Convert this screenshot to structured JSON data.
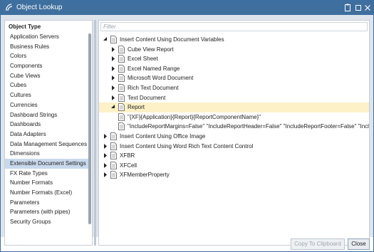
{
  "window": {
    "title": "Object Lookup",
    "colors": {
      "titlebar": "#3e6f9e",
      "selection": "#c9d9ed",
      "tree_selection": "#fcf1c7",
      "body": "#dde4ec"
    }
  },
  "left_panel": {
    "header": "Object Type",
    "selected_index": 16,
    "items": [
      "Application Servers",
      "Business Rules",
      "Colors",
      "Components",
      "Cube Views",
      "Cubes",
      "Cultures",
      "Currencies",
      "Dashboard Strings",
      "Dashboards",
      "Data Adapters",
      "Data Management Sequences",
      "Dimensions",
      "Extensible Document Settings",
      "FX Rate Types",
      "Number Formats",
      "Number Formats (Excel)",
      "Parameters",
      "Parameters (with pipes)",
      "Security Groups"
    ]
  },
  "filter": {
    "placeholder": "Filter",
    "value": ""
  },
  "tree": [
    {
      "label": "Insert Content Using Document Variables",
      "level": 0,
      "state": "expanded",
      "selected": false
    },
    {
      "label": "Cube View Report",
      "level": 1,
      "state": "collapsed",
      "selected": false
    },
    {
      "label": "Excel Sheet",
      "level": 1,
      "state": "collapsed",
      "selected": false
    },
    {
      "label": "Excel Named Range",
      "level": 1,
      "state": "collapsed",
      "selected": false
    },
    {
      "label": "Microsoft Word Document",
      "level": 1,
      "state": "collapsed",
      "selected": false
    },
    {
      "label": "Rich Text Document",
      "level": 1,
      "state": "collapsed",
      "selected": false
    },
    {
      "label": "Text Document",
      "level": 1,
      "state": "collapsed",
      "selected": false
    },
    {
      "label": "Report",
      "level": 1,
      "state": "expanded",
      "selected": true
    },
    {
      "label": "\"{XF}{Application}{Report}{ReportComponentName}\"",
      "level": 2,
      "state": "leaf",
      "selected": false
    },
    {
      "label": "\"IncludeReportMargins=False\" \"IncludeReportHeader=False\" \"IncludeReportFooter=False\" \"Includ",
      "level": 2,
      "state": "leaf",
      "selected": false
    },
    {
      "label": "Insert Content Using Office Image",
      "level": 0,
      "state": "collapsed",
      "selected": false
    },
    {
      "label": "Insert Content Using Word Rich Text Content Control",
      "level": 0,
      "state": "collapsed",
      "selected": false
    },
    {
      "label": "XFBR",
      "level": 0,
      "state": "collapsed",
      "selected": false
    },
    {
      "label": "XFCell",
      "level": 0,
      "state": "collapsed",
      "selected": false
    },
    {
      "label": "XFMemberProperty",
      "level": 0,
      "state": "collapsed",
      "selected": false
    }
  ],
  "footer": {
    "copy_label": "Copy To Clipboard",
    "close_label": "Close"
  },
  "icons": {
    "app": "onestream-logo-icon",
    "clipboard": "clipboard-icon",
    "maximize": "maximize-icon",
    "close": "close-icon"
  }
}
